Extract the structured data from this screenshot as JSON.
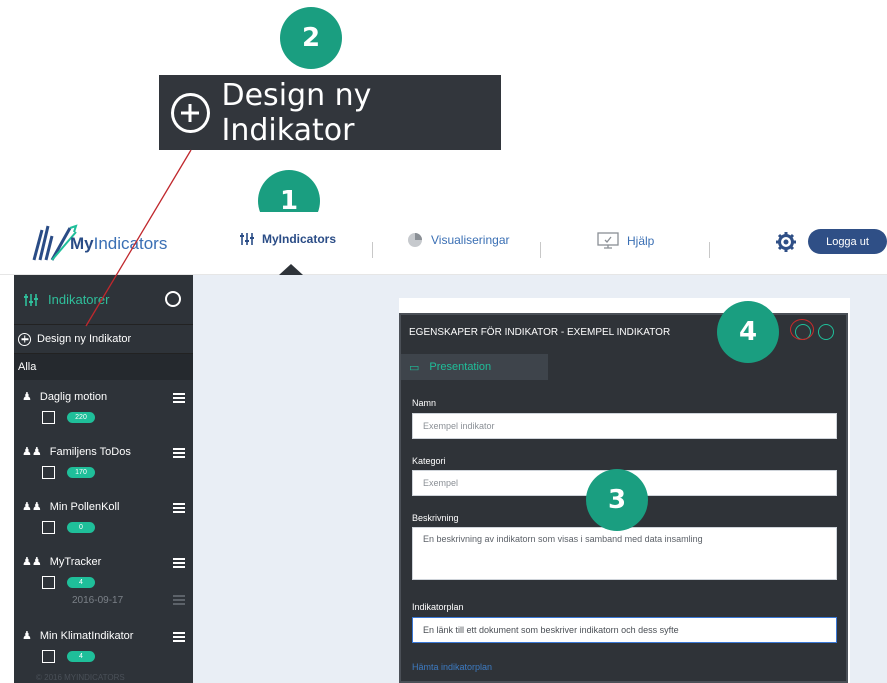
{
  "callouts": {
    "step1": "1",
    "step2": "2",
    "step3": "3",
    "step4": "4",
    "zoom_label": "Design ny Indikator"
  },
  "topnav": {
    "logo_text_prefix": "My",
    "logo_text_suffix": "Indicators",
    "items": [
      {
        "label": "MyIndicators",
        "icon": "sliders-icon"
      },
      {
        "label": "Visualiseringar",
        "icon": "pie-chart-icon"
      },
      {
        "label": "Hjälp",
        "icon": "monitor-icon"
      }
    ],
    "logout_label": "Logga ut"
  },
  "sidebar": {
    "title": "Indikatorer",
    "design_new": "Design ny Indikator",
    "filter": "Alla",
    "indicators": [
      {
        "name": "Daglig motion",
        "count": "220",
        "icon": "person-icon"
      },
      {
        "name": "Familjens ToDos",
        "count": "170",
        "icon": "group-icon"
      },
      {
        "name": "Min PollenKoll",
        "count": "0",
        "icon": "group-icon"
      },
      {
        "name": "MyTracker",
        "count": "4",
        "icon": "group-icon",
        "date": "2016-09-17"
      },
      {
        "name": "Min KlimatIndikator",
        "count": "4",
        "icon": "person-icon"
      }
    ],
    "copyright": "© 2016 MYINDICATORS"
  },
  "dialog": {
    "title": "EGENSKAPER FÖR INDIKATOR - EXEMPEL INDIKATOR",
    "tab": "Presentation",
    "namn_label": "Namn",
    "namn_value": "Exempel indikator",
    "kategori_label": "Kategori",
    "kategori_value": "Exempel",
    "beskrivning_label": "Beskrivning",
    "beskrivning_value": "En beskrivning av indikatorn som visas i samband med data insamling",
    "indikatorplan_label": "Indikatorplan",
    "indikatorplan_value": "En länk till ett dokument som beskriver indikatorn och dess syfte",
    "hamta_link": "Hämta indikatorplan"
  },
  "colors": {
    "accent": "#1a9e80",
    "sidebar_bg": "#2e3339",
    "brand_blue": "#2f4f86",
    "callout_line": "#c0282d"
  }
}
